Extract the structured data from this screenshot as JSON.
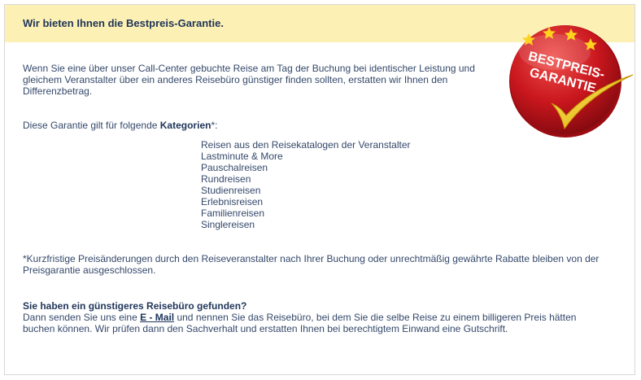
{
  "header": {
    "title": "Wir bieten Ihnen die Bestpreis-Garantie."
  },
  "intro": {
    "text": "Wenn Sie eine über unser Call-Center gebuchte Reise am Tag der Buchung bei identischer Leistung und gleichem Veranstalter über ein anderes Reisebüro günstiger finden sollten, erstatten wir Ihnen den Differenzbetrag."
  },
  "garantie": {
    "prefix": "Diese Garantie gilt für folgende ",
    "bold": "Kategorien",
    "suffix": "*:"
  },
  "categories": [
    "Reisen aus den Reisekatalogen der Veranstalter",
    "Lastminute & More",
    "Pauschalreisen",
    "Rundreisen",
    "Studienreisen",
    "Erlebnisreisen",
    "Familienreisen",
    "Singlereisen"
  ],
  "footnote": {
    "text": "*Kurzfristige Preisänderungen durch den Reiseveranstalter nach Ihrer Buchung oder unrechtmäßig gewährte Rabatte bleiben von der Preisgarantie ausgeschlossen."
  },
  "contact": {
    "question": "Sie haben ein günstigeres Reisebüro gefunden?",
    "before": "Dann senden Sie uns eine ",
    "link": "E - Mail",
    "after": " und nennen Sie das Reisebüro, bei dem Sie die selbe Reise zu einem billigeren Preis hätten buchen können. Wir prüfen dann den Sachverhalt und erstatten Ihnen bei berechtigtem Einwand eine Gutschrift."
  },
  "badge": {
    "line1": "BESTPREIS-",
    "line2": "GARANTIE",
    "colors": {
      "disc": "#c8161d",
      "disc_dark": "#8e0b10",
      "stars": "#ffd21e",
      "check": "#f2c500"
    }
  },
  "colors": {
    "header_bg": "#fcf0b4",
    "title": "#1f3559",
    "body_text": "#34486a",
    "border": "#d8d8d8"
  }
}
